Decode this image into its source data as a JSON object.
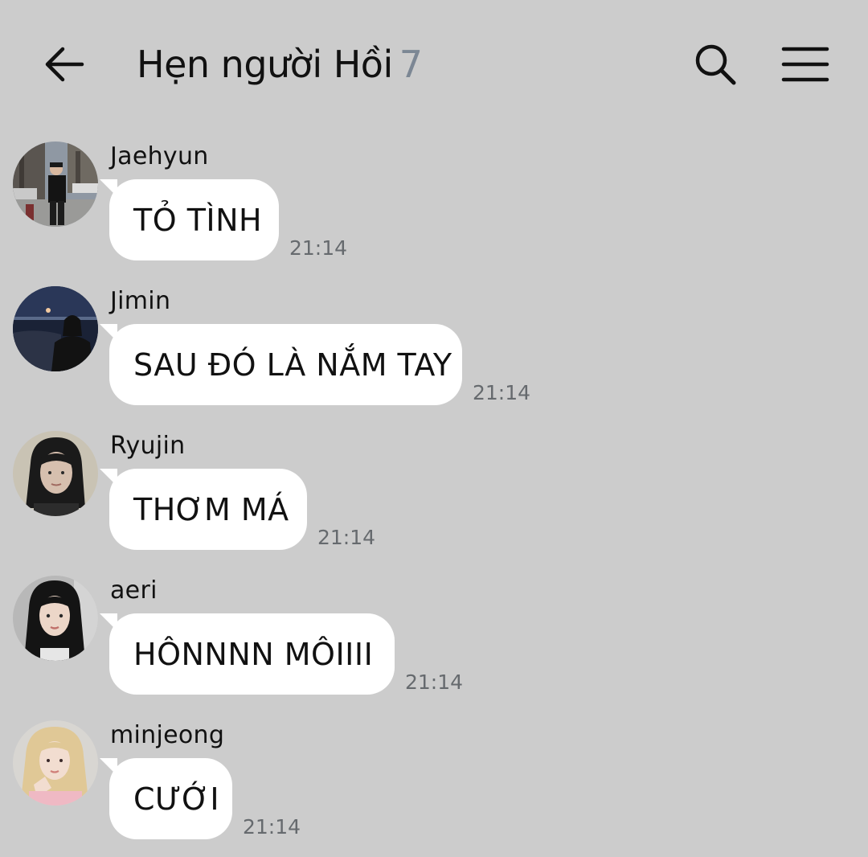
{
  "header": {
    "back_icon": "arrow-left-icon",
    "title": "Hẹn người Hồi",
    "member_count": "7",
    "search_icon": "search-icon",
    "menu_icon": "hamburger-menu-icon"
  },
  "messages": [
    {
      "sender": "Jaehyun",
      "text": "TỎ TÌNH",
      "time": "21:14"
    },
    {
      "sender": "Jimin",
      "text": "SAU ĐÓ LÀ NẮM TAY",
      "time": "21:14"
    },
    {
      "sender": "Ryujin",
      "text": "THƠM MÁ",
      "time": "21:14"
    },
    {
      "sender": "aeri",
      "text": "HÔNNNN MÔIIII",
      "time": "21:14"
    },
    {
      "sender": "minjeong",
      "text": "CƯỚI",
      "time": "21:14"
    }
  ],
  "colors": {
    "background": "#cccccc",
    "bubble": "#ffffff",
    "member_count": "#7c8794",
    "time": "#666a6e"
  }
}
